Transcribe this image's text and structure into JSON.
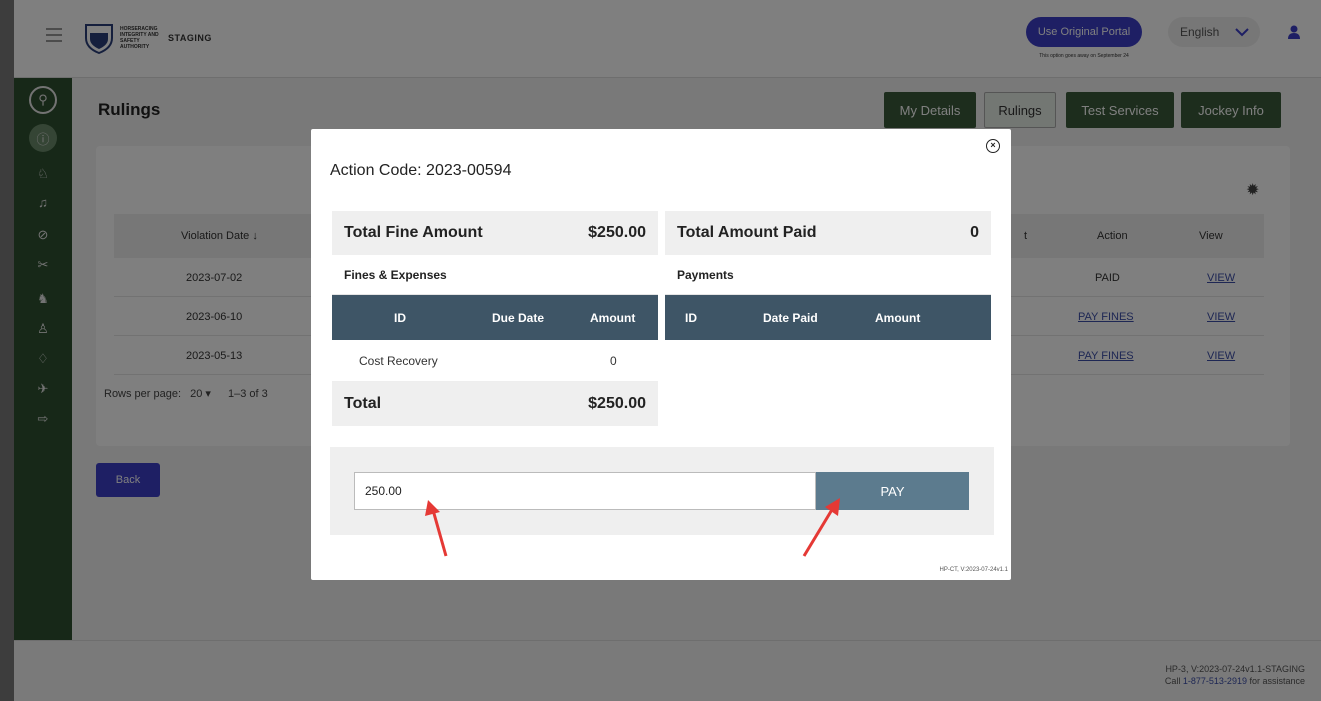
{
  "header": {
    "logo_text": "HORSERACING INTEGRITY AND SAFETY AUTHORITY",
    "env_label": "STAGING",
    "portal_button": "Use Original Portal",
    "portal_note": "This option goes away on September 24",
    "language": "English"
  },
  "page": {
    "title": "Rulings",
    "tabs": [
      "My Details",
      "Rulings",
      "Test Services",
      "Jockey Info"
    ],
    "active_tab": "Rulings"
  },
  "table": {
    "headers": {
      "violation_date": "Violation Date ↓",
      "partial": "t",
      "action": "Action",
      "view": "View"
    },
    "rows": [
      {
        "date": "2023-07-02",
        "action": "PAID",
        "view": "VIEW"
      },
      {
        "date": "2023-06-10",
        "action": "PAY FINES",
        "view": "VIEW"
      },
      {
        "date": "2023-05-13",
        "action": "PAY FINES",
        "view": "VIEW"
      }
    ],
    "rows_per_page_label": "Rows per page:",
    "rows_per_page_value": "20",
    "pagination": "1–3 of 3"
  },
  "back_button": "Back",
  "footer": {
    "version": "HP-3, V:2023-07-24v1.1-STAGING",
    "call_prefix": "Call ",
    "phone": "1-877-513-2919",
    "call_suffix": " for assistance"
  },
  "modal": {
    "title": "Action Code: 2023-00594",
    "fines": {
      "header_label": "Total Fine Amount",
      "header_value": "$250.00",
      "section": "Fines & Expenses",
      "columns": [
        "ID",
        "Due Date",
        "Amount"
      ],
      "rows": [
        {
          "id": "Cost Recovery",
          "due_date": "",
          "amount": "0"
        }
      ],
      "total_label": "Total",
      "total_value": "$250.00"
    },
    "payments": {
      "header_label": "Total Amount Paid",
      "header_value": "0",
      "section": "Payments",
      "columns": [
        "ID",
        "Date Paid",
        "Amount"
      ]
    },
    "pay_input_value": "250.00",
    "pay_button": "PAY",
    "version": "HP-CT, V:2023-07-24v1.1"
  },
  "colors": {
    "sidebar": "#2f5130",
    "primary_button": "#3c3fc9",
    "table_header": "#3e5566",
    "pay_button": "#5c7b8e",
    "annotation_arrow": "#e53935"
  }
}
